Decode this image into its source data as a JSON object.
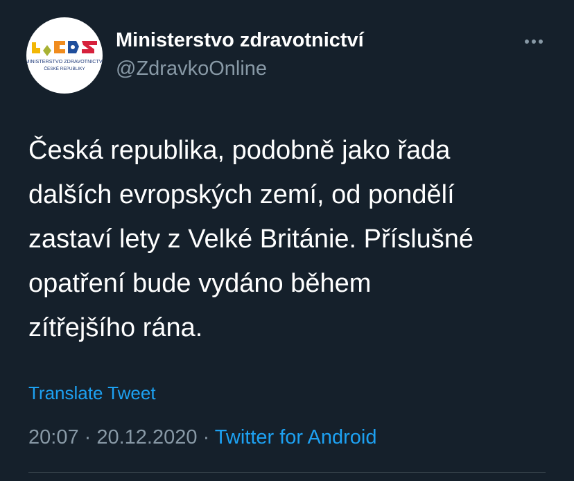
{
  "author": {
    "display_name": "Ministerstvo zdravotnictví",
    "handle": "@ZdravkoOnline",
    "logo_text_line1": "MINISTERSTVO ZDRAVOTNICTVÍ",
    "logo_text_line2": "ČESKÉ REPUBLIKY"
  },
  "tweet": {
    "text": "Česká republika, podobně jako řada\ndalších evropských zemí, od pondělí\nzastaví lety z Velké Británie. Příslušné\nopatření bude vydáno během\nzítřejšího rána.",
    "translate_label": "Translate Tweet",
    "time": "20:07",
    "separator": " · ",
    "date": "20.12.2020",
    "source": "Twitter for Android"
  },
  "icons": {
    "more": "more-icon"
  },
  "colors": {
    "background": "#15202b",
    "text": "#ffffff",
    "secondary": "#8899a6",
    "accent": "#1da1f2",
    "divider": "#38444d"
  }
}
